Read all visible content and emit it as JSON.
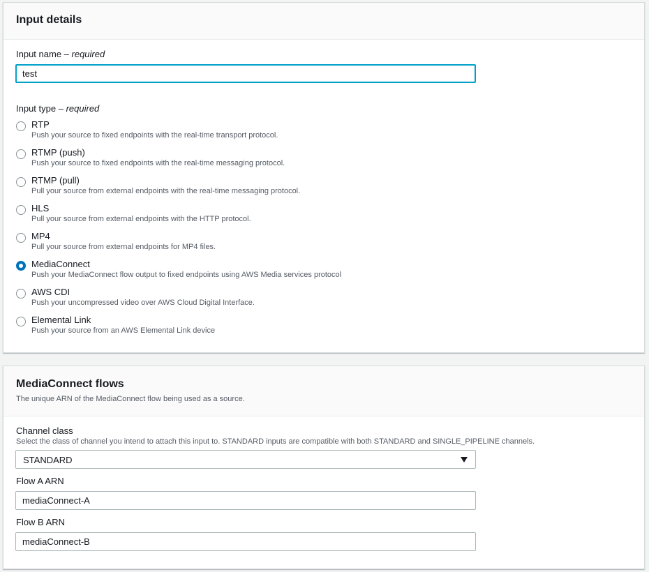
{
  "input_details": {
    "title": "Input details",
    "name_label": "Input name",
    "name_required": "– required",
    "name_value": "test",
    "type_label": "Input type",
    "type_required": "– required",
    "types": [
      {
        "label": "RTP",
        "desc": "Push your source to fixed endpoints with the real-time transport protocol.",
        "checked": false
      },
      {
        "label": "RTMP (push)",
        "desc": "Push your source to fixed endpoints with the real-time messaging protocol.",
        "checked": false
      },
      {
        "label": "RTMP (pull)",
        "desc": "Pull your source from external endpoints with the real-time messaging protocol.",
        "checked": false
      },
      {
        "label": "HLS",
        "desc": "Pull your source from external endpoints with the HTTP protocol.",
        "checked": false
      },
      {
        "label": "MP4",
        "desc": "Pull your source from external endpoints for MP4 files.",
        "checked": false
      },
      {
        "label": "MediaConnect",
        "desc": "Push your MediaConnect flow output to fixed endpoints using AWS Media services protocol",
        "checked": true
      },
      {
        "label": "AWS CDI",
        "desc": "Push your uncompressed video over AWS Cloud Digital Interface.",
        "checked": false
      },
      {
        "label": "Elemental Link",
        "desc": "Push your source from an AWS Elemental Link device",
        "checked": false
      }
    ]
  },
  "mediaconnect": {
    "title": "MediaConnect flows",
    "description": "The unique ARN of the MediaConnect flow being used as a source.",
    "channel_class_label": "Channel class",
    "channel_class_hint": "Select the class of channel you intend to attach this input to. STANDARD inputs are compatible with both STANDARD and SINGLE_PIPELINE channels.",
    "channel_class_value": "STANDARD",
    "flow_a_label": "Flow A ARN",
    "flow_a_value": "mediaConnect-A",
    "flow_b_label": "Flow B ARN",
    "flow_b_value": "mediaConnect-B"
  },
  "colors": {
    "accent": "#0073bb",
    "focus": "#00a1c9",
    "text": "#16191f",
    "muted": "#545b64"
  }
}
